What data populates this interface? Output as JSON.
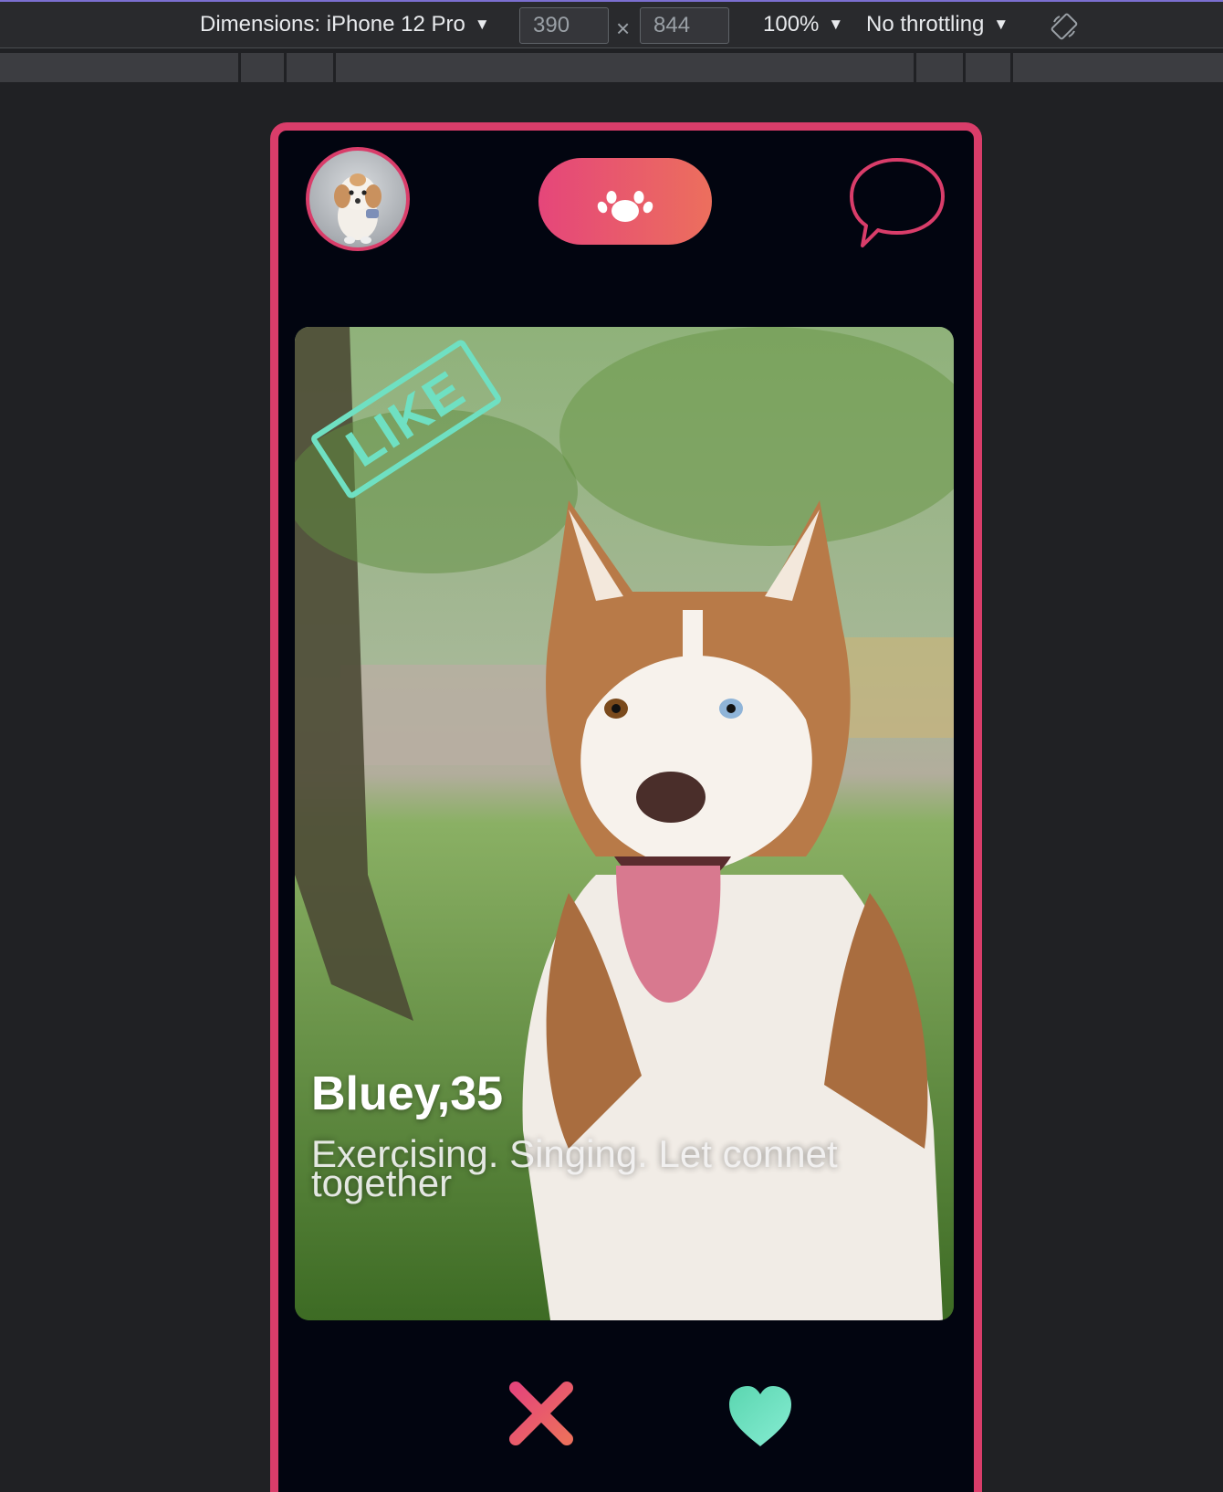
{
  "devtools": {
    "dimensions_label": "Dimensions: iPhone 12 Pro",
    "width_value": "390",
    "height_value": "844",
    "times_symbol": "×",
    "zoom": "100%",
    "throttling": "No throttling",
    "caret": "▼"
  },
  "app": {
    "like_stamp": "LIKE",
    "profile": {
      "name_age": "Bluey,35",
      "bio": "Exercising. Singing. Let connet together"
    }
  },
  "colors": {
    "accent_pink": "#d93d6a",
    "gradient_start": "#e5467a",
    "gradient_end": "#ec6f5d",
    "like_green": "#6fe0c2",
    "background": "#020510"
  },
  "icons": [
    "rotate-icon",
    "paw-icon",
    "chat-icon",
    "close-icon",
    "heart-icon"
  ]
}
